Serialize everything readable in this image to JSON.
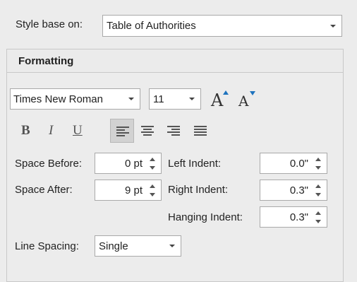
{
  "style_base": {
    "label": "Style base on:",
    "value": "Table of Authorities"
  },
  "formatting": {
    "title": "Formatting",
    "font_name": "Times New Roman",
    "font_size": "11",
    "grow_font_glyph": "A",
    "shrink_font_glyph": "A",
    "bold": "B",
    "italic": "I",
    "underline": "U",
    "alignments": [
      {
        "name": "left",
        "active": true
      },
      {
        "name": "center",
        "active": false
      },
      {
        "name": "right",
        "active": false
      },
      {
        "name": "justify",
        "active": false
      }
    ],
    "space_before": {
      "label": "Space Before:",
      "value": "0 pt"
    },
    "space_after": {
      "label": "Space After:",
      "value": "9 pt"
    },
    "left_indent": {
      "label": "Left Indent:",
      "value": "0.0\""
    },
    "right_indent": {
      "label": "Right Indent:",
      "value": "0.3\""
    },
    "hanging_indent": {
      "label": "Hanging Indent:",
      "value": "0.3\""
    },
    "line_spacing": {
      "label": "Line Spacing:",
      "value": "Single"
    }
  },
  "colors": {
    "arrow_blue": "#1e73be",
    "active_bg": "#d2d2d2"
  }
}
